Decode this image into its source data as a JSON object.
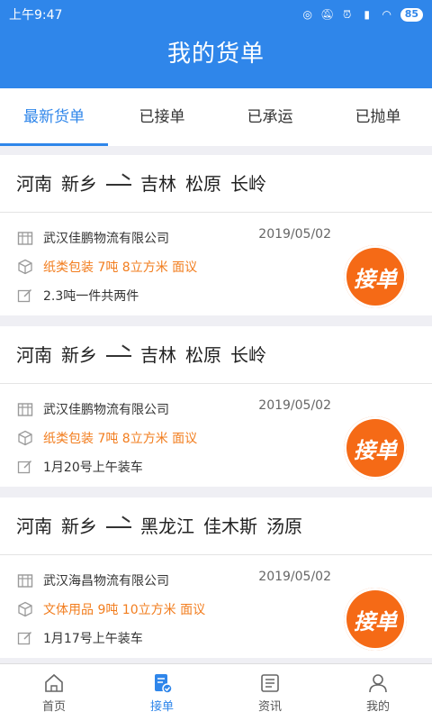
{
  "status": {
    "time": "上午9:47",
    "battery": "85"
  },
  "header": {
    "title": "我的货单"
  },
  "tabs": [
    {
      "label": "最新货单",
      "active": true
    },
    {
      "label": "已接单",
      "active": false
    },
    {
      "label": "已承运",
      "active": false
    },
    {
      "label": "已抛单",
      "active": false
    }
  ],
  "orders": [
    {
      "from": [
        "河南",
        "新乡"
      ],
      "to": [
        "吉林",
        "松原",
        "长岭"
      ],
      "company": "武汉佳鹏物流有限公司",
      "date": "2019/05/02",
      "cargo": "纸类包装 7吨 8立方米 面议",
      "note": "2.3吨一件共两件",
      "action": "接单"
    },
    {
      "from": [
        "河南",
        "新乡"
      ],
      "to": [
        "吉林",
        "松原",
        "长岭"
      ],
      "company": "武汉佳鹏物流有限公司",
      "date": "2019/05/02",
      "cargo": "纸类包装 7吨 8立方米 面议",
      "note": "1月20号上午装车",
      "action": "接单"
    },
    {
      "from": [
        "河南",
        "新乡"
      ],
      "to": [
        "黑龙江",
        "佳木斯",
        "汤原"
      ],
      "company": "武汉海昌物流有限公司",
      "date": "2019/05/02",
      "cargo": "文体用品 9吨 10立方米 面议",
      "note": "1月17号上午装车",
      "action": "接单"
    }
  ],
  "nav": [
    {
      "label": "首页",
      "icon": "home-icon",
      "active": false
    },
    {
      "label": "接单",
      "icon": "order-icon",
      "active": true
    },
    {
      "label": "资讯",
      "icon": "news-icon",
      "active": false
    },
    {
      "label": "我的",
      "icon": "user-icon",
      "active": false
    }
  ]
}
